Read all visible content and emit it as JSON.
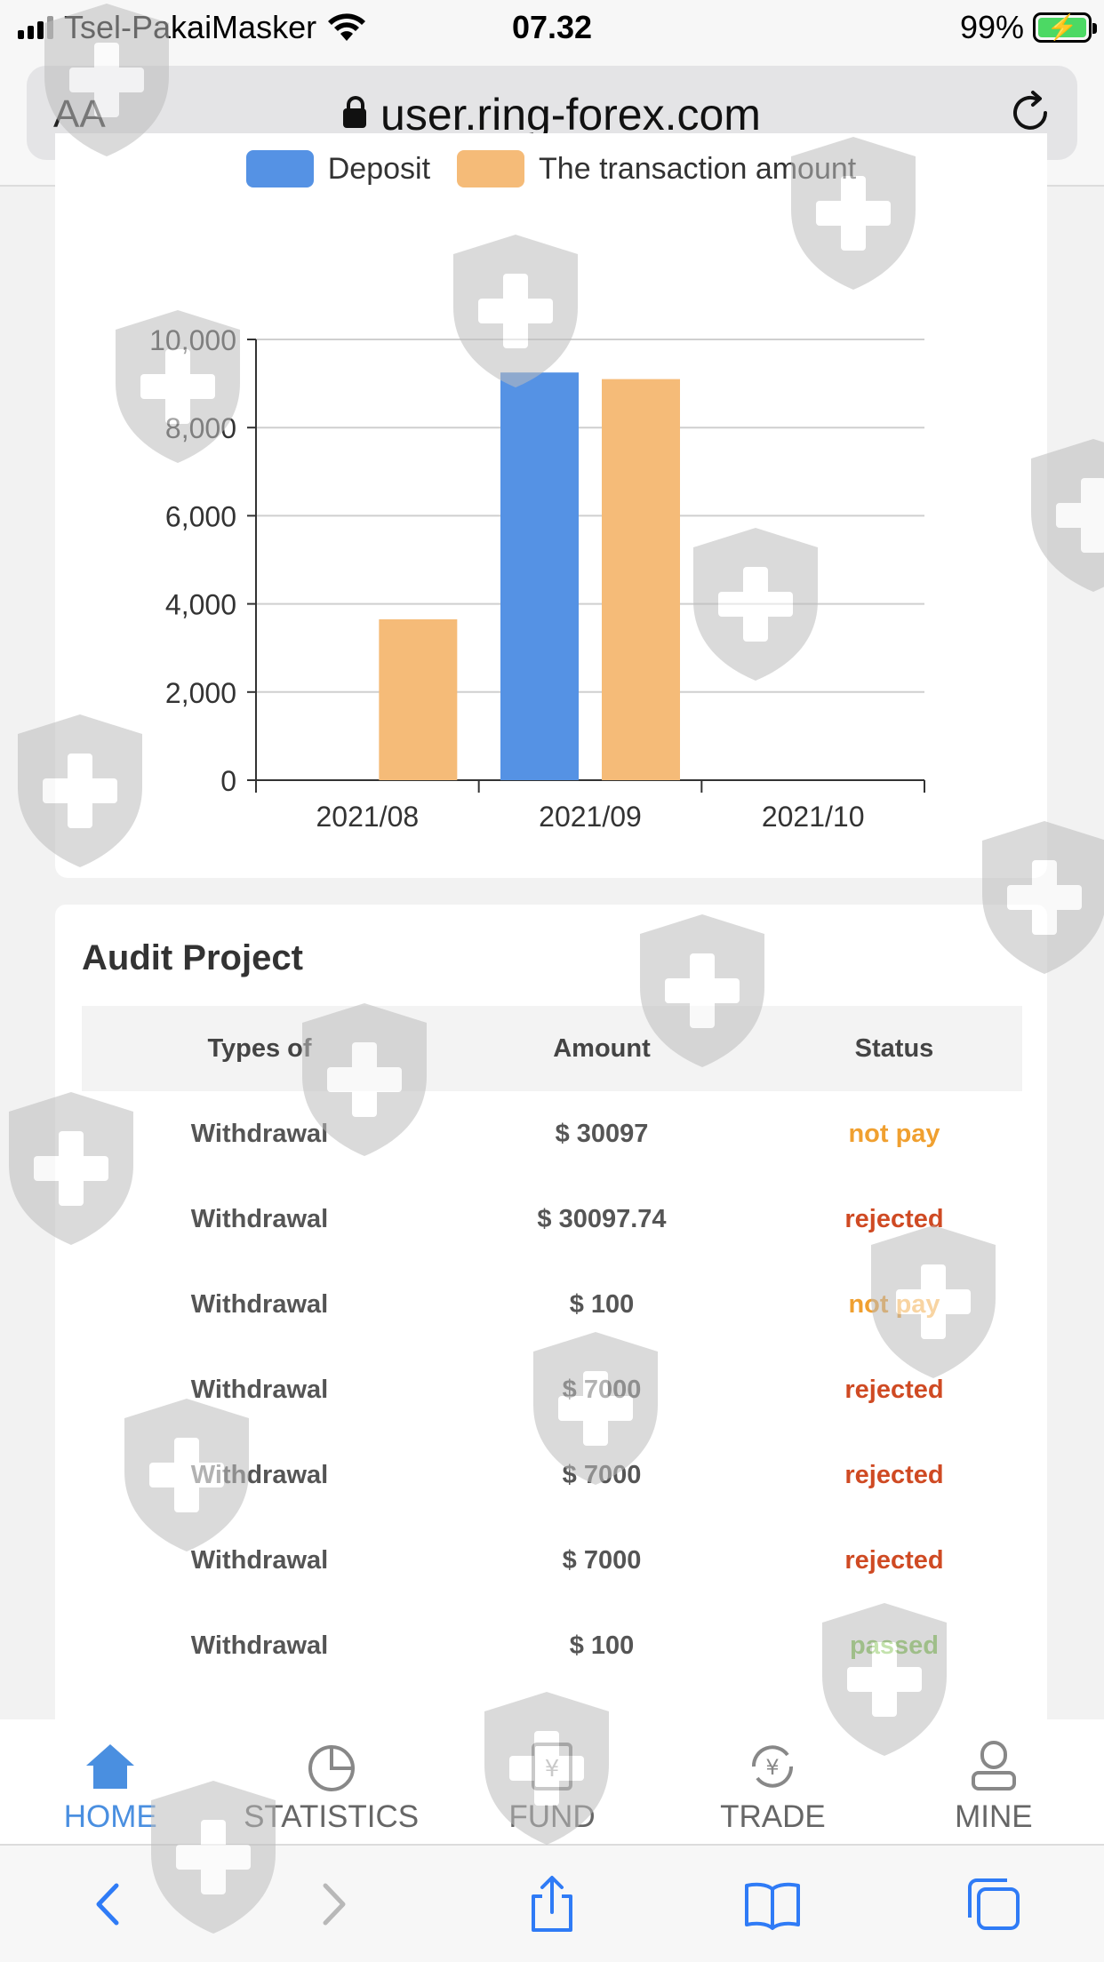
{
  "status_bar": {
    "carrier": "Tsel-PakaiMasker",
    "time": "07.32",
    "battery": "99%"
  },
  "browser": {
    "text_size_label": "AA",
    "url": "user.ring-forex.com"
  },
  "chart_data": {
    "type": "bar",
    "categories": [
      "2021/08",
      "2021/09",
      "2021/10"
    ],
    "series": [
      {
        "name": "Deposit",
        "color": "#5592e4",
        "values": [
          0,
          9250,
          0
        ]
      },
      {
        "name": "The transaction amount",
        "color": "#f5bb78",
        "values": [
          3650,
          9100,
          0
        ]
      }
    ],
    "ylim": [
      0,
      10000
    ],
    "yticks": [
      "0",
      "2,000",
      "4,000",
      "6,000",
      "8,000",
      "10,000"
    ],
    "ytick_values": [
      0,
      2000,
      4000,
      6000,
      8000,
      10000
    ],
    "grid": true,
    "legend_position": "top-center",
    "title": "",
    "xlabel": "",
    "ylabel": ""
  },
  "audit": {
    "title": "Audit Project",
    "headers": [
      "Types of",
      "Amount",
      "Status"
    ],
    "rows": [
      {
        "type": "Withdrawal",
        "amount": "$ 30097",
        "status": "not pay",
        "kind": "not"
      },
      {
        "type": "Withdrawal",
        "amount": "$ 30097.74",
        "status": "rejected",
        "kind": "rej"
      },
      {
        "type": "Withdrawal",
        "amount": "$ 100",
        "status": "not pay",
        "kind": "not"
      },
      {
        "type": "Withdrawal",
        "amount": "$ 7000",
        "status": "rejected",
        "kind": "rej"
      },
      {
        "type": "Withdrawal",
        "amount": "$ 7000",
        "status": "rejected",
        "kind": "rej"
      },
      {
        "type": "Withdrawal",
        "amount": "$ 7000",
        "status": "rejected",
        "kind": "rej"
      },
      {
        "type": "Withdrawal",
        "amount": "$ 100",
        "status": "passed",
        "kind": "pass"
      }
    ]
  },
  "app_nav": {
    "items": [
      {
        "label": "HOME",
        "icon": "home-icon",
        "active": true
      },
      {
        "label": "STATISTICS",
        "icon": "pie-chart-icon",
        "active": false
      },
      {
        "label": "FUND",
        "icon": "yen-box-icon",
        "active": false
      },
      {
        "label": "TRADE",
        "icon": "yen-exchange-icon",
        "active": false
      },
      {
        "label": "MINE",
        "icon": "user-icon",
        "active": false
      }
    ]
  },
  "safari_toolbar": {
    "icons": [
      "back-icon",
      "forward-icon",
      "share-icon",
      "bookmarks-icon",
      "tabs-icon"
    ]
  },
  "colors": {
    "accent": "#4a8fe0",
    "deposit": "#5592e4",
    "transaction": "#f5bb78",
    "not_pay": "#f0a030",
    "rejected": "#cf4a23",
    "passed": "#7cc04a"
  }
}
